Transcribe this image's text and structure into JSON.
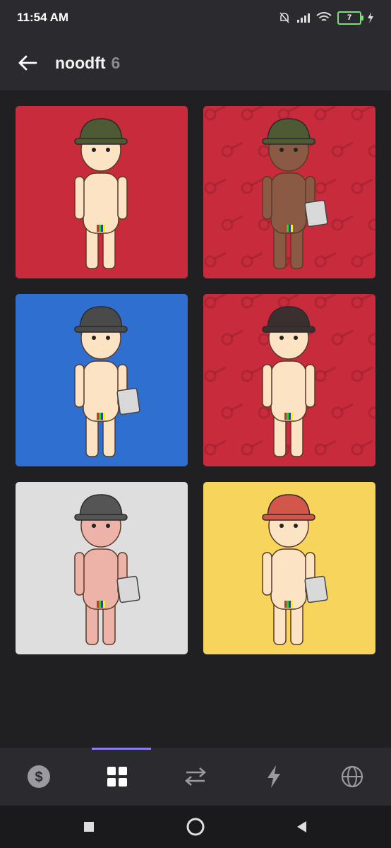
{
  "status_bar": {
    "time": "11:54 AM",
    "battery": "7"
  },
  "header": {
    "title": "noodft",
    "count": "6"
  },
  "nfts": [
    {
      "bg": "#c72b3c",
      "pattern": false
    },
    {
      "bg": "#c72b3c",
      "pattern": true
    },
    {
      "bg": "#2f6fd0",
      "pattern": false
    },
    {
      "bg": "#c72b3c",
      "pattern": true
    },
    {
      "bg": "#dedede",
      "pattern": false
    },
    {
      "bg": "#f7d45c",
      "pattern": false
    }
  ],
  "nav": {
    "items": [
      {
        "icon": "dollar-icon"
      },
      {
        "icon": "grid-icon",
        "active": true
      },
      {
        "icon": "swap-icon"
      },
      {
        "icon": "lightning-icon"
      },
      {
        "icon": "globe-icon"
      }
    ]
  },
  "colors": {
    "active": "#ffffff",
    "inactive": "#9a9aa0",
    "indicator": "#8a7cf0"
  }
}
